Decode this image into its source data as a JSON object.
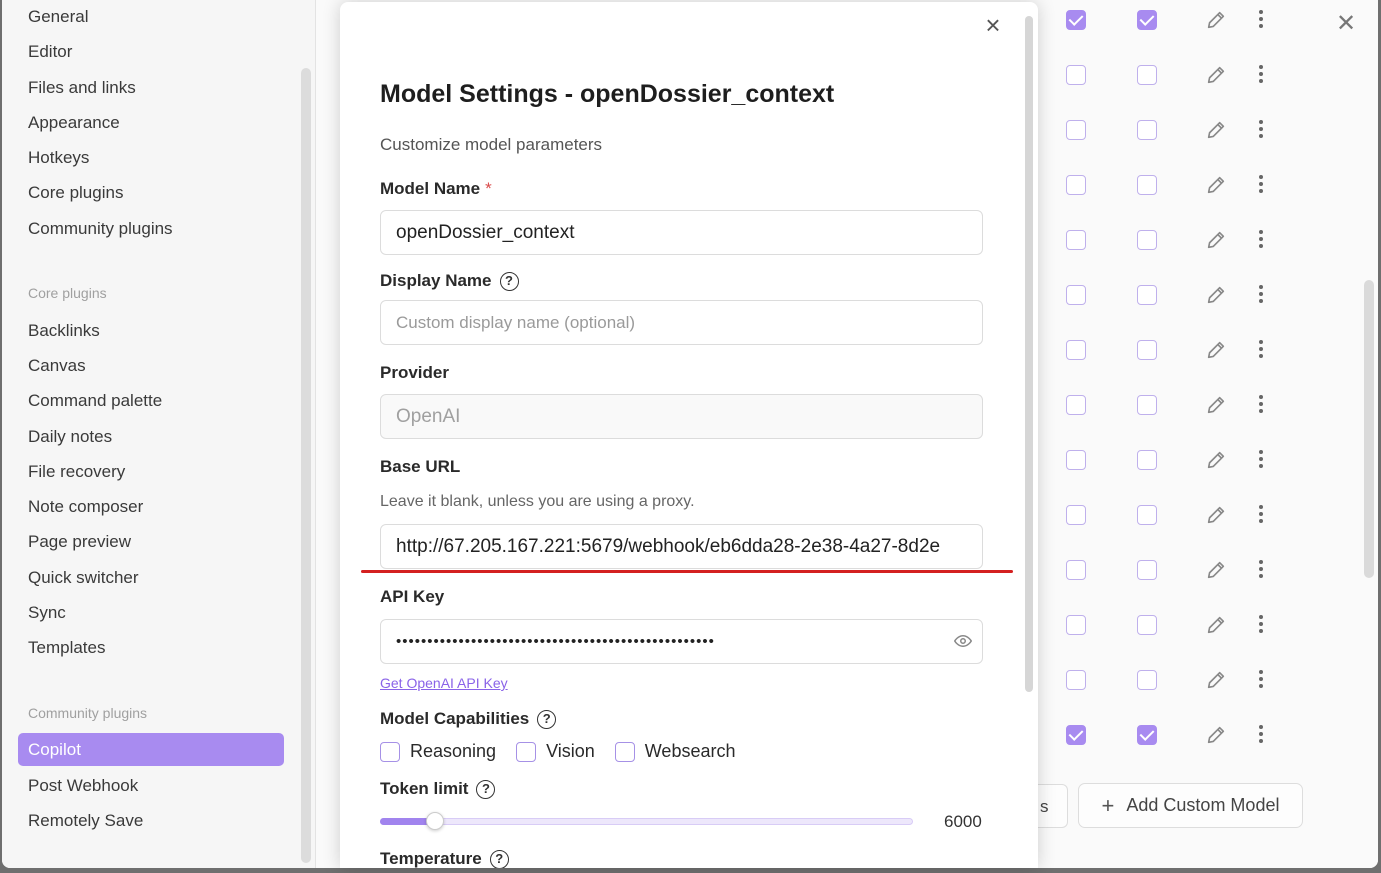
{
  "sidebar": {
    "options": [
      "General",
      "Editor",
      "Files and links",
      "Appearance",
      "Hotkeys",
      "Core plugins",
      "Community plugins"
    ],
    "core_heading": "Core plugins",
    "core": [
      "Backlinks",
      "Canvas",
      "Command palette",
      "Daily notes",
      "File recovery",
      "Note composer",
      "Page preview",
      "Quick switcher",
      "Sync",
      "Templates"
    ],
    "community_heading": "Community plugins",
    "community": [
      "Copilot",
      "Post Webhook",
      "Remotely Save"
    ],
    "active": "Copilot"
  },
  "background": {
    "partial_button_label": "s",
    "add_custom_model_label": "Add Custom Model",
    "rows_checked": [
      true,
      false,
      false,
      false,
      false,
      false,
      false,
      false,
      false,
      false,
      false,
      false,
      false,
      true
    ]
  },
  "modal": {
    "title": "Model Settings - openDossier_context",
    "description": "Customize model parameters",
    "model_name_label": "Model Name",
    "required_mark": "*",
    "model_name_value": "openDossier_context",
    "display_name_label": "Display Name",
    "display_name_placeholder": "Custom display name (optional)",
    "provider_label": "Provider",
    "provider_value": "OpenAI",
    "base_url_label": "Base URL",
    "base_url_hint": "Leave it blank, unless you are using a proxy.",
    "base_url_value": "http://67.205.167.221:5679/webhook/eb6dda28-2e38-4a27-8d2e",
    "api_key_label": "API Key",
    "api_key_value": "•••••••••••••••••••••••••••••••••••••••••••••••••••",
    "api_key_link": "Get OpenAI API Key",
    "capabilities_label": "Model Capabilities",
    "capabilities": [
      "Reasoning",
      "Vision",
      "Websearch"
    ],
    "token_limit_label": "Token limit",
    "token_limit_value": "6000",
    "token_limit_fraction": 0.1,
    "temperature_label": "Temperature"
  },
  "colors": {
    "accent": "#a88bf0",
    "highlight_line": "#d42020"
  }
}
